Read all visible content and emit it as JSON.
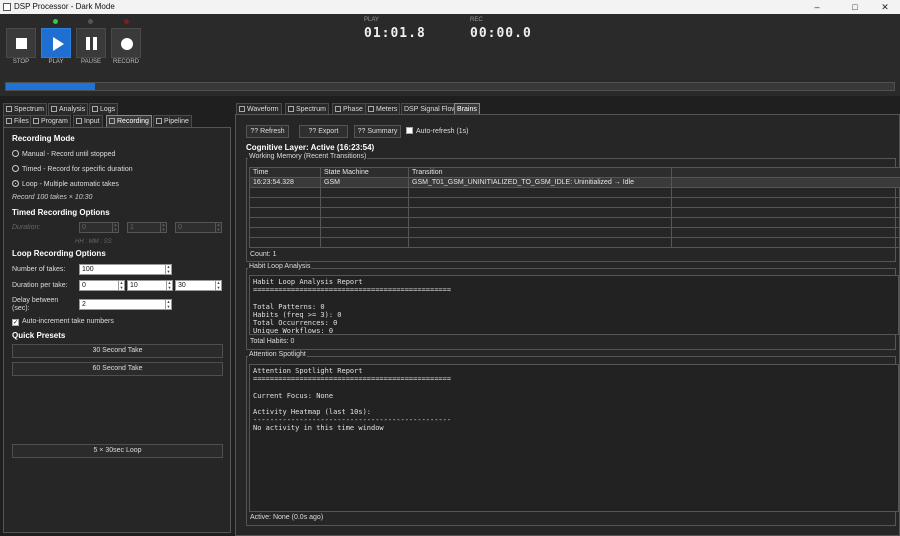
{
  "window": {
    "title": "DSP Processor - Dark Mode",
    "controls": {
      "minimize": "–",
      "maximize": "□",
      "close": "✕"
    }
  },
  "transport": {
    "buttons": [
      {
        "label": "STOP",
        "icon": "stop-icon",
        "led": ""
      },
      {
        "label": "PLAY",
        "icon": "play-icon",
        "led": "#2ecc40"
      },
      {
        "label": "PAUSE",
        "icon": "pause-icon",
        "led": "#555555"
      },
      {
        "label": "RECORD",
        "icon": "record-icon",
        "led": "#7a2020"
      }
    ],
    "play_caption": "PLAY",
    "play_time": "01:01.8",
    "rec_caption": "REC",
    "rec_time": "00:00.0",
    "progress_fraction": 0.1,
    "accent": "#1d73d6"
  },
  "left_tabs": {
    "row1": [
      "Spectrum",
      "Analysis",
      "Logs"
    ],
    "row2": [
      "Files",
      "Program",
      "Input",
      "Recording",
      "Pipeline"
    ],
    "selected": "Recording"
  },
  "recording": {
    "mode_header": "Recording Mode",
    "modes": [
      {
        "label": "Manual - Record until stopped",
        "selected": false
      },
      {
        "label": "Timed - Record for specific duration",
        "selected": false
      },
      {
        "label": "Loop - Multiple automatic takes",
        "selected": true
      }
    ],
    "summary": "Record 100 takes × 10:30",
    "timed_header": "Timed Recording Options",
    "duration_label": "Duration:",
    "duration_values": [
      "0",
      "1",
      "0"
    ],
    "duration_format": "HH : MM : SS",
    "loop_header": "Loop Recording Options",
    "takes_label": "Number of takes:",
    "takes_value": "100",
    "duration_per_take_label": "Duration per take:",
    "duration_per_take_values": [
      "0",
      "10",
      "30"
    ],
    "delay_label_1": "Delay between",
    "delay_label_2": "(sec):",
    "delay_value": "2",
    "auto_increment_label": "Auto-increment take numbers",
    "auto_increment_checked": true,
    "presets_header": "Quick Presets",
    "presets": [
      "30 Second Take",
      "60 Second Take"
    ],
    "loop_preset": "5 × 30sec Loop"
  },
  "right_tabs": {
    "items": [
      "Waveform",
      "Spectrum",
      "Phase",
      "Meters",
      "DSP Signal Flow",
      "Brains"
    ],
    "selected": "Brains"
  },
  "brains": {
    "toolbar": {
      "refresh": "?? Refresh",
      "export": "?? Export",
      "summary": "?? Summary",
      "auto_refresh": "Auto-refresh (1s)"
    },
    "cognitive_title": "Cognitive Layer: Active (16:23:54)",
    "working_memory_label": "Working Memory (Recent Transitions)",
    "table_headers": [
      "Time",
      "State Machine",
      "Transition"
    ],
    "table_rows": [
      [
        "16:23:54.328",
        "GSM",
        "GSM_T01_GSM_UNINITIALIZED_TO_GSM_IDLE: Uninitialized → Idle"
      ]
    ],
    "count_text": "Count: 1",
    "habit_label": "Habit Loop Analysis",
    "habit_report": "Habit Loop Analysis Report\n===============================================\n\nTotal Patterns: 0\nHabits (freq >= 3): 0\nTotal Occurrences: 0\nUnique Workflows: 0",
    "total_habits": "Total Habits: 0",
    "attention_label": "Attention Spotlight",
    "attention_report": "Attention Spotlight Report\n===============================================\n\nCurrent Focus: None\n\nActivity Heatmap (last 10s):\n-----------------------------------------------\nNo activity in this time window",
    "active_status": "Active: None (0.0s ago)"
  }
}
